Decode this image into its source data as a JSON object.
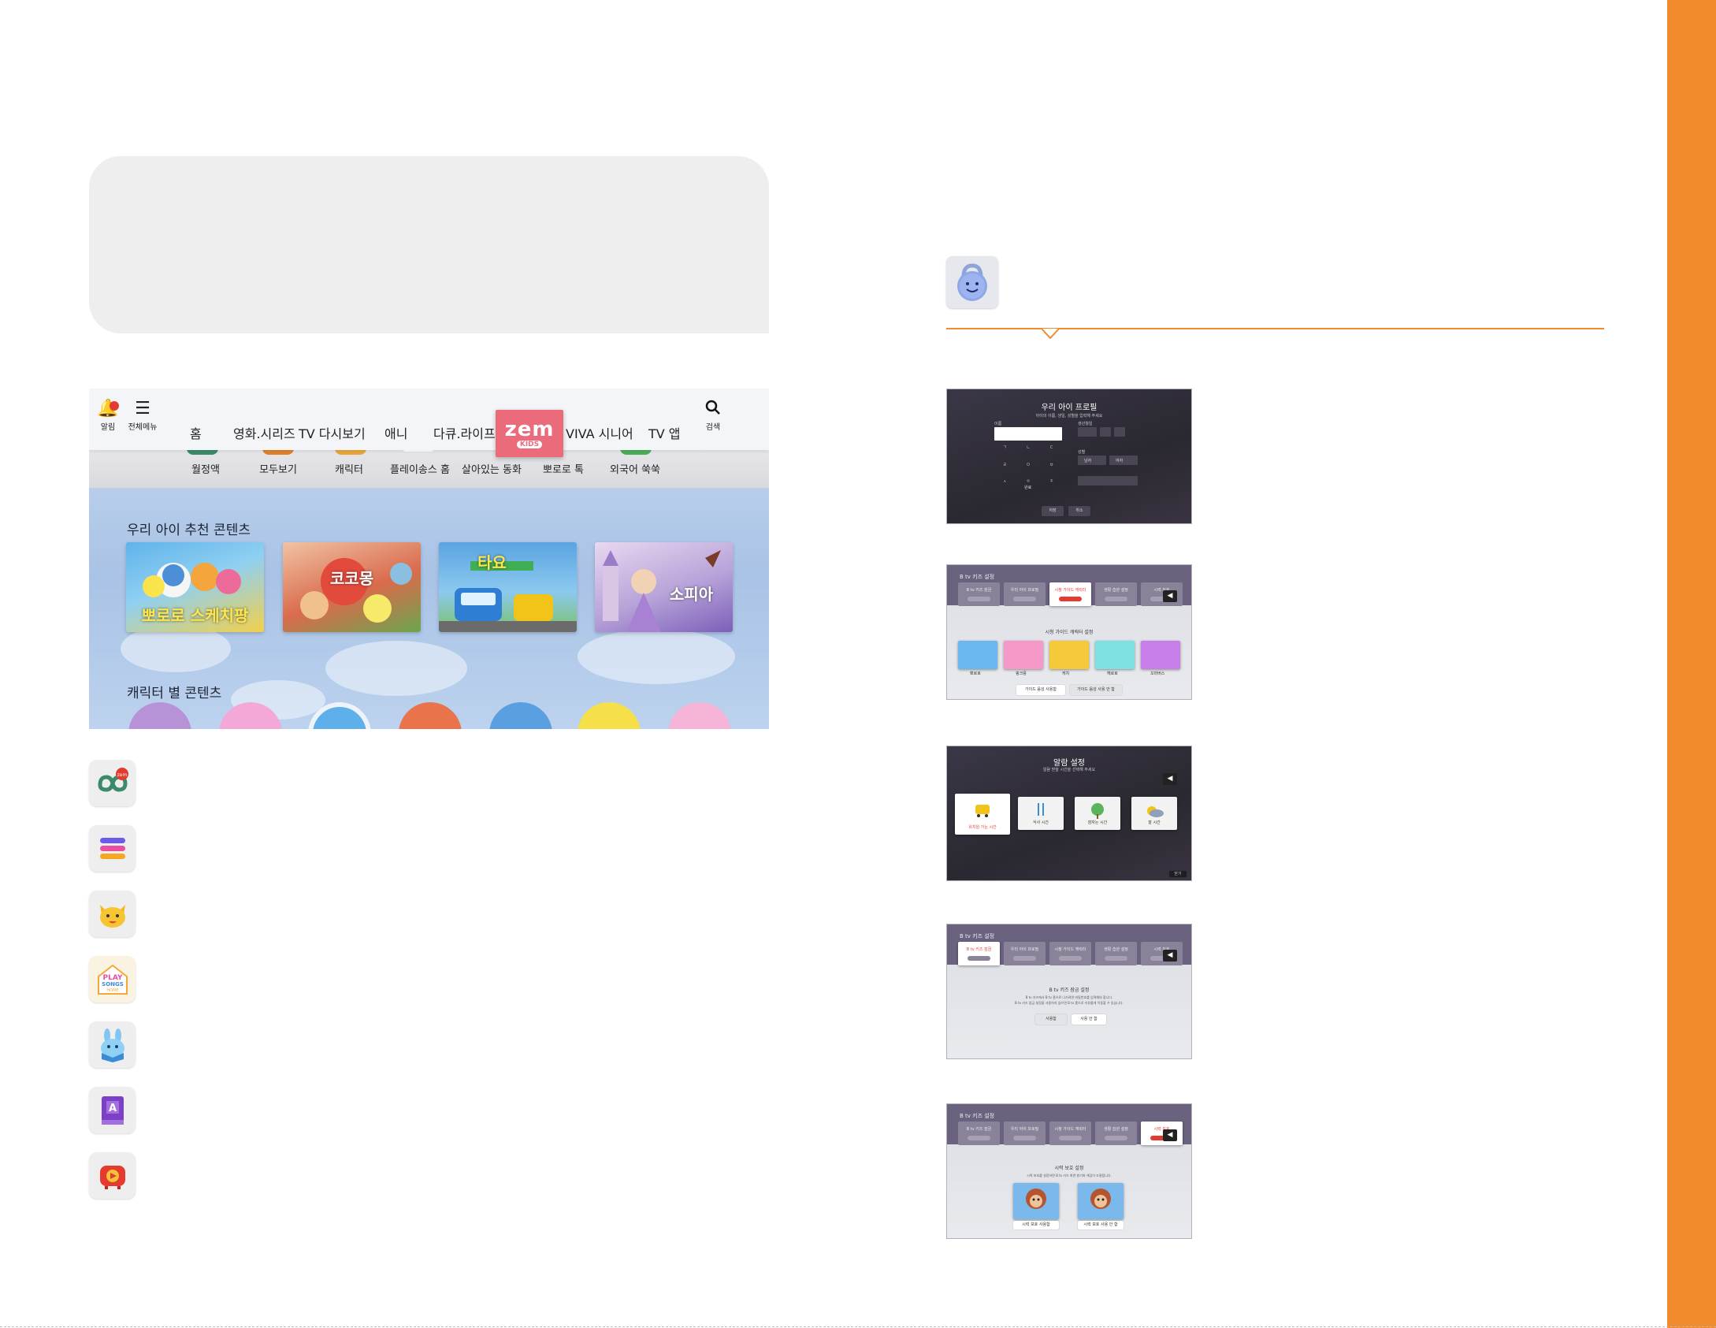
{
  "main_screenshot": {
    "topbar": {
      "alarm_label": "알림",
      "menu_label": "전체메뉴",
      "menu_items": [
        "홈",
        "영화.시리즈",
        "TV 다시보기",
        "애니",
        "다큐.라이프",
        "VIVA 시니어",
        "TV 앱"
      ],
      "zem_logo": "zem",
      "zem_sub": "KIDS",
      "search_label": "검색"
    },
    "subnav": [
      "월정액",
      "모두보기",
      "캐릭터",
      "플레이송스 홈",
      "살아있는 동화",
      "뽀로로 톡",
      "외국어 쑥쑥"
    ],
    "recommend": {
      "title": "우리 아이 추천 콘텐츠",
      "thumbs": [
        "뽀로로 스케치팡",
        "코코몽",
        "타요",
        "소피아"
      ]
    },
    "characters_title": "캐릭터 별 콘텐츠"
  },
  "app_icons": [
    "zem-kids-icon",
    "menu-stack-icon",
    "cat-character-icon",
    "play-songs-home-icon",
    "rabbit-book-icon",
    "a-book-icon",
    "video-play-icon"
  ],
  "play_songs_icon_text": [
    "PLAY",
    "SONGS",
    "HOME"
  ],
  "zem_badge": "zem",
  "right_column": {
    "guard_icon": "smile-lock-icon",
    "screens": {
      "profile": {
        "title": "우리 아이 프로필",
        "subtitle": "아이의 이름, 생일, 성별을 입력해 주세요",
        "name_label": "이름",
        "birth_label": "생년월일",
        "gender_label": "성별",
        "gender_options": [
          "남자",
          "여자"
        ],
        "keys": [
          "ㄱ",
          "ㄴ",
          "ㄷ",
          "ㄹ",
          "ㅁ",
          "ㅂ",
          "ㅅ",
          "ㅇ",
          "ㅈ"
        ],
        "done_label": "완료",
        "save_label": "저장",
        "cancel_label": "취소"
      },
      "guide": {
        "header": "B tv 키즈 설정",
        "tabs": [
          "B tv 키즈 잠금",
          "우리 아이 프로필",
          "시청 가이드 캐릭터",
          "생활 습관 설정",
          "시력 보호"
        ],
        "title": "시청 가이드 캐릭터 설정",
        "characters": [
          "뽀로로",
          "핑크퐁",
          "캐치",
          "헤로로",
          "꼬마버스"
        ],
        "option_on": "가이드 음성 사용함",
        "option_off": "가이드 음성 사용 안 함"
      },
      "alarm": {
        "title": "알람 설정",
        "subtitle": "알람 받을 시간을 선택해 주세요",
        "cards": [
          "유치원 가는 시간",
          "식사 시간",
          "잠자는 시간",
          "잘 시간"
        ],
        "footer": "닫기"
      },
      "lock": {
        "header": "B tv 키즈 설정",
        "tabs": [
          "B tv 키즈 잠금",
          "우리 아이 프로필",
          "시청 가이드 캐릭터",
          "생활 습관 설정",
          "시력 보호"
        ],
        "title": "B tv 키즈 잠금 설정",
        "desc1": "B tv 키즈에서 B tv 홈으로 나가려면 비밀번호를 입력해야 합니다.",
        "desc2": "B tv 키즈 잠금 설정을 사용하지 않으면 B tv 홈으로 자유롭게 이동할 수 있습니다.",
        "opt_on": "사용함",
        "opt_off": "사용 안 함"
      },
      "eye": {
        "header": "B tv 키즈 설정",
        "tabs": [
          "B tv 키즈 잠금",
          "우리 아이 프로필",
          "시청 가이드 캐릭터",
          "생활 습관 설정",
          "시력 보호"
        ],
        "title": "시력 보호 설정",
        "desc": "시력 보호를 설정하면 B tv 키즈 화면 밝기와 색감이 조절됩니다.",
        "opt_on": "시력 보호 사용함",
        "opt_off": "시력 보호 사용 안 함"
      }
    }
  },
  "colors": {
    "accent": "#f28a2e",
    "zem": "#ec6b7b",
    "panel": "#eeeeee"
  }
}
